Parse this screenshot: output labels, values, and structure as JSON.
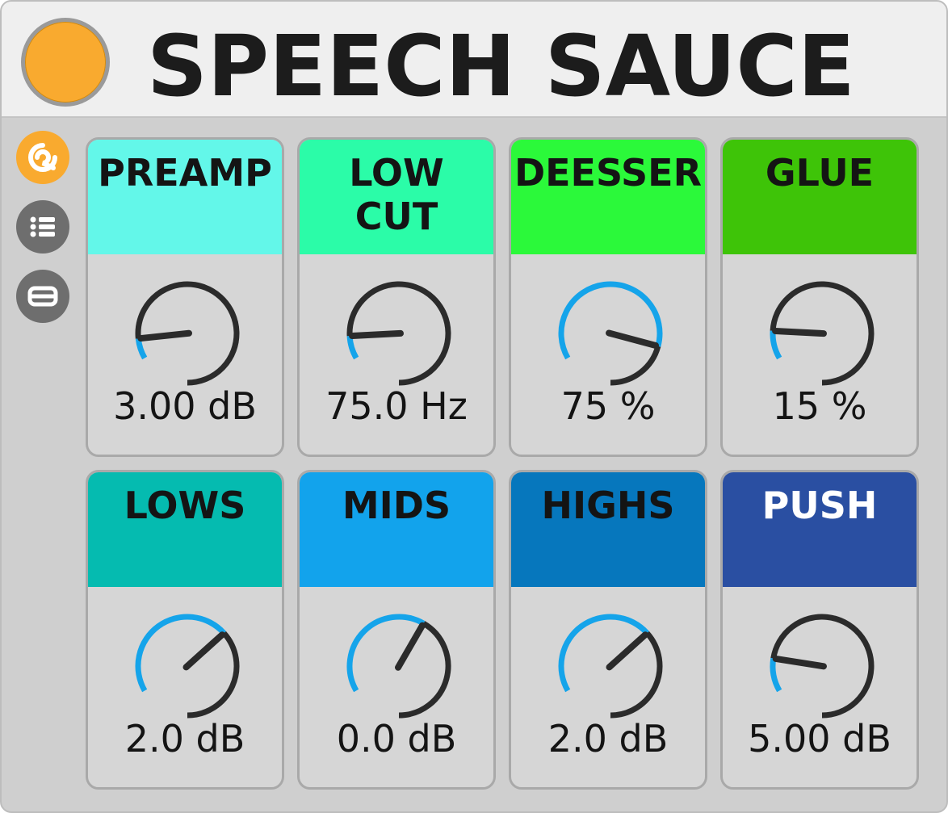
{
  "header": {
    "title": "SPEECH SAUCE",
    "power_color": "#F9AA2F"
  },
  "sidebar": {
    "items": [
      {
        "name": "hot-swap-button",
        "icon": "power-hook-icon",
        "bg": "#F9AA2F",
        "fg": "#ffffff"
      },
      {
        "name": "list-button",
        "icon": "list-icon",
        "bg": "#6e6e6e",
        "fg": "#ffffff"
      },
      {
        "name": "panel-toggle-button",
        "icon": "collapse-icon",
        "bg": "#6e6e6e",
        "fg": "#ffffff"
      }
    ]
  },
  "colors": {
    "knob_track": "#2b2b2b",
    "knob_value_arc": "#15a4ea"
  },
  "modules": [
    {
      "label": "PREAMP",
      "value": "3.00 dB",
      "color": "#63F7E9",
      "label_color": "#141414",
      "knob_fraction": 0.08
    },
    {
      "label": "LOW\nCUT",
      "value": "75.0 Hz",
      "color": "#2BFCA8",
      "label_color": "#141414",
      "knob_fraction": 0.09
    },
    {
      "label": "DEESSER",
      "value": "75 %",
      "color": "#2BF93A",
      "label_color": "#141414",
      "knob_fraction": 0.75
    },
    {
      "label": "GLUE",
      "value": "15 %",
      "color": "#3EC408",
      "label_color": "#141414",
      "knob_fraction": 0.11
    },
    {
      "label": "LOWS",
      "value": "2.0 dB",
      "color": "#05BBB0",
      "label_color": "#141414",
      "knob_fraction": 0.56
    },
    {
      "label": "MIDS",
      "value": "0.0 dB",
      "color": "#12A3EC",
      "label_color": "#141414",
      "knob_fraction": 0.5
    },
    {
      "label": "HIGHS",
      "value": "2.0 dB",
      "color": "#0677BD",
      "label_color": "#141414",
      "knob_fraction": 0.56
    },
    {
      "label": "PUSH",
      "value": "5.00 dB",
      "color": "#2A4FA2",
      "label_color": "#ffffff",
      "knob_fraction": 0.13
    }
  ]
}
